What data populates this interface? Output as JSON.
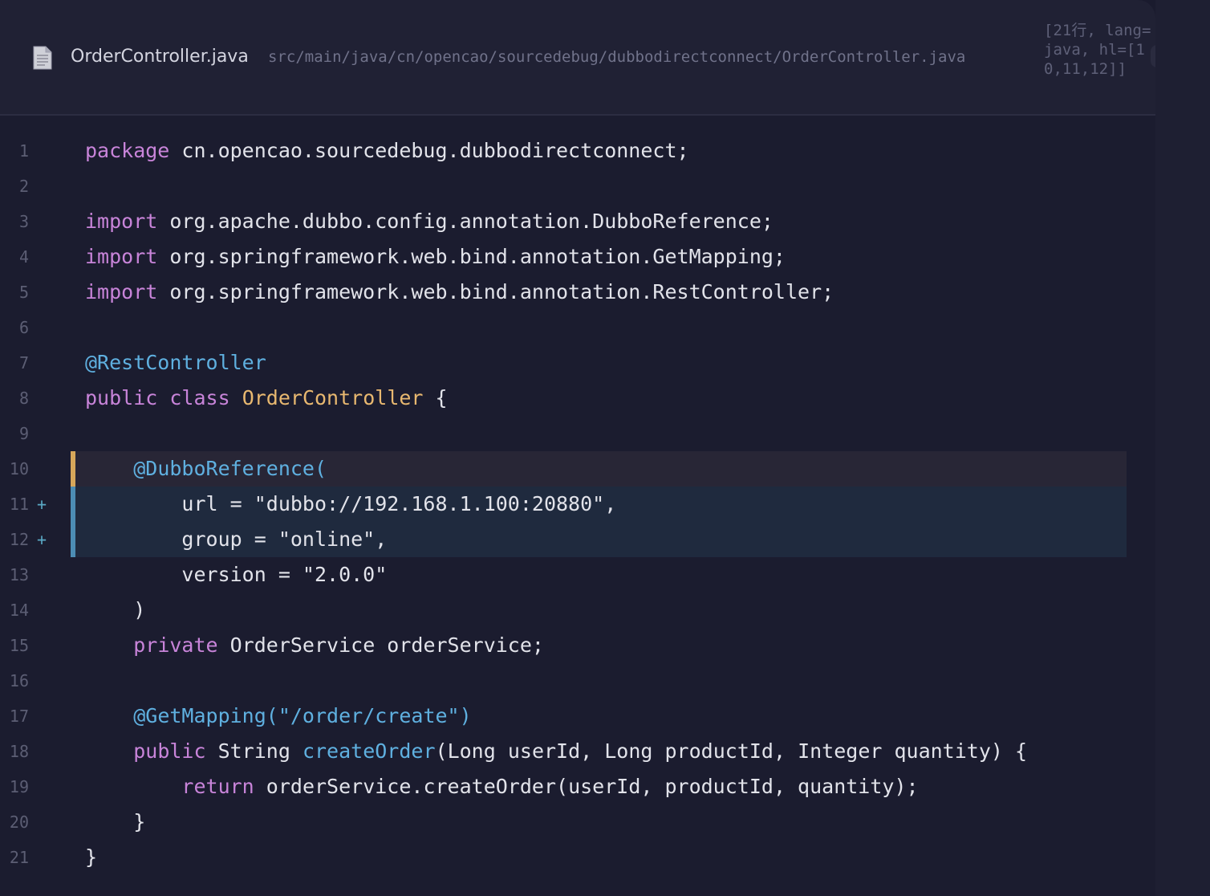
{
  "header": {
    "file_icon": "document-icon",
    "file_name": "OrderController.java",
    "file_path": "src/main/java/cn/opencao/sourcedebug/dubbodirectconnect/OrderController.java",
    "meta": "[21行, lang=java, hl=[10,11,12]]"
  },
  "colors": {
    "keyword": "#c884d9",
    "annotation": "#5fb0e0",
    "class_name": "#e8b870",
    "text": "#e2e3ea",
    "highlight_yellow": "#d7a75a",
    "highlight_blue": "#4c8db4"
  },
  "lines": [
    {
      "n": "1",
      "marker": "",
      "hl": "",
      "tokens": [
        [
          "kw",
          "package"
        ],
        [
          "t",
          " cn.opencao.sourcedebug.dubbodirectconnect;"
        ]
      ]
    },
    {
      "n": "2",
      "marker": "",
      "hl": "",
      "tokens": []
    },
    {
      "n": "3",
      "marker": "",
      "hl": "",
      "tokens": [
        [
          "kw",
          "import"
        ],
        [
          "t",
          " org.apache.dubbo.config.annotation.DubboReference;"
        ]
      ]
    },
    {
      "n": "4",
      "marker": "",
      "hl": "",
      "tokens": [
        [
          "kw",
          "import"
        ],
        [
          "t",
          " org.springframework.web.bind.annotation.GetMapping;"
        ]
      ]
    },
    {
      "n": "5",
      "marker": "",
      "hl": "",
      "tokens": [
        [
          "kw",
          "import"
        ],
        [
          "t",
          " org.springframework.web.bind.annotation.RestController;"
        ]
      ]
    },
    {
      "n": "6",
      "marker": "",
      "hl": "",
      "tokens": []
    },
    {
      "n": "7",
      "marker": "",
      "hl": "",
      "tokens": [
        [
          "ann",
          "@RestController"
        ]
      ]
    },
    {
      "n": "8",
      "marker": "",
      "hl": "",
      "tokens": [
        [
          "kw",
          "public"
        ],
        [
          "t",
          " "
        ],
        [
          "kw",
          "class"
        ],
        [
          "t",
          " "
        ],
        [
          "cls",
          "OrderController"
        ],
        [
          "t",
          " {"
        ]
      ]
    },
    {
      "n": "9",
      "marker": "",
      "hl": "",
      "tokens": []
    },
    {
      "n": "10",
      "marker": "",
      "hl": "yellow",
      "tokens": [
        [
          "t",
          "    "
        ],
        [
          "ann",
          "@DubboReference("
        ]
      ]
    },
    {
      "n": "11",
      "marker": "+",
      "hl": "blue",
      "tokens": [
        [
          "t",
          "        url = \"dubbo://192.168.1.100:20880\","
        ]
      ]
    },
    {
      "n": "12",
      "marker": "+",
      "hl": "blue",
      "tokens": [
        [
          "t",
          "        group = \"online\","
        ]
      ]
    },
    {
      "n": "13",
      "marker": "",
      "hl": "",
      "tokens": [
        [
          "t",
          "        version = \"2.0.0\""
        ]
      ]
    },
    {
      "n": "14",
      "marker": "",
      "hl": "",
      "tokens": [
        [
          "t",
          "    )"
        ]
      ]
    },
    {
      "n": "15",
      "marker": "",
      "hl": "",
      "tokens": [
        [
          "t",
          "    "
        ],
        [
          "kw",
          "private"
        ],
        [
          "t",
          " OrderService orderService;"
        ]
      ]
    },
    {
      "n": "16",
      "marker": "",
      "hl": "",
      "tokens": []
    },
    {
      "n": "17",
      "marker": "",
      "hl": "",
      "tokens": [
        [
          "t",
          "    "
        ],
        [
          "ann",
          "@GetMapping(\"/order/create\")"
        ]
      ]
    },
    {
      "n": "18",
      "marker": "",
      "hl": "",
      "tokens": [
        [
          "t",
          "    "
        ],
        [
          "kw",
          "public"
        ],
        [
          "t",
          " String "
        ],
        [
          "fn",
          "createOrder"
        ],
        [
          "t",
          "(Long userId, Long productId, Integer quantity) {"
        ]
      ]
    },
    {
      "n": "19",
      "marker": "",
      "hl": "",
      "tokens": [
        [
          "t",
          "        "
        ],
        [
          "kw",
          "return"
        ],
        [
          "t",
          " orderService.createOrder(userId, productId, quantity);"
        ]
      ]
    },
    {
      "n": "20",
      "marker": "",
      "hl": "",
      "tokens": [
        [
          "t",
          "    }"
        ]
      ]
    },
    {
      "n": "21",
      "marker": "",
      "hl": "",
      "tokens": [
        [
          "t",
          "}"
        ]
      ]
    }
  ]
}
